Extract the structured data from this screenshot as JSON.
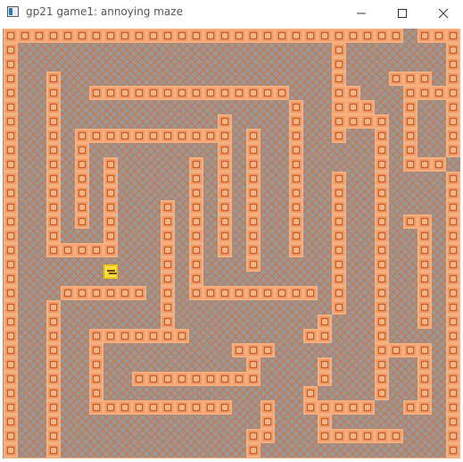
{
  "window": {
    "title": "gp21 game1: annoying maze",
    "icon": "app-window-icon",
    "controls": [
      "minimize-icon",
      "maximize-icon",
      "close-icon"
    ]
  },
  "game": {
    "cols": 32,
    "rows": 30,
    "player": {
      "col": 7,
      "row": 16
    },
    "colors": {
      "floor": "#989898",
      "floor_pattern": "#c07a55",
      "wall": "#f09864",
      "wall_border": "#f4b080",
      "player": "#ffd72a"
    },
    "maze": [
      "############################.###",
      "#......................#.......#",
      "#......................#.......#",
      "#..#...................#...###.#",
      "#..#..##############...##...####",
      "#..#................#..###..#..#",
      "#..#...........#....#..####.#..#",
      "#..#.###########.#..#..#..#.#..#",
      "#..#.#.........#.#..#.....#.#..#",
      "#..#.#.#.....#.#.#..#.....#.###.",
      "#..#.#.#.....#.#.#..#..#..#....#",
      "#..#.#.#.....#.#.#..#..#..#....#",
      "#..#.#.#...#.#.#.#..#..#..#....#",
      "#..#.#.#...#.#.#.#..#..#..#.##.#",
      "#..#...#...#.#.#.#..#..#..#..#.#",
      "#..#####...#.#.#.#..#..#..#..#.#",
      "#..........#.#...#.....#..#..#.#",
      "#..........#.#.........#..#..#.#",
      "#...######.#.#########.#..#..#.#",
      "#..#.......#...........#..#..#.#",
      "#..#.......#..........#...#..#.#",
      "#..#..#######........##...#....#",
      "#..#..#.........###.......####.#",
      "#..#..#..........#....#...#..#.#",
      "#..#..#..#########....#...#..#.#",
      "#..#..#..............#....#..#.#",
      "#..#..##########..#..#####..##.#",
      "#..#..............#...#........#",
      "#..#.............##...######...#",
      "#..#.............#.............#",
      "################################"
    ]
  }
}
